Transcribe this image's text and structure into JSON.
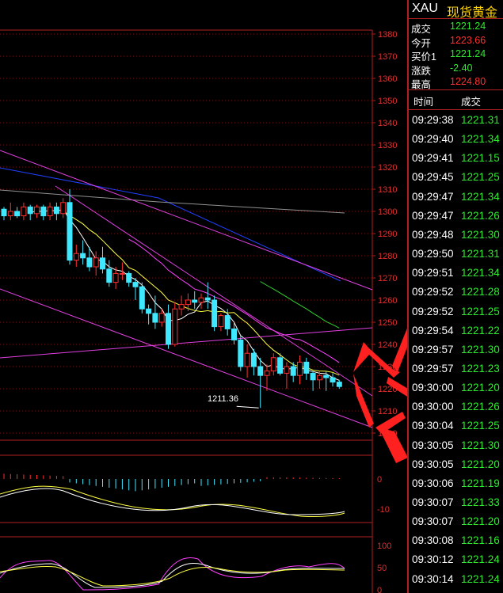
{
  "header": {
    "symbol": "XAU",
    "name": "现货黄金"
  },
  "quote": [
    {
      "label": "成交",
      "value": "1221.24",
      "color": "#2fe82f"
    },
    {
      "label": "今开",
      "value": "1223.66",
      "color": "#ff3030"
    },
    {
      "label": "买价1",
      "value": "1221.24",
      "color": "#2fe82f"
    },
    {
      "label": "涨跌",
      "value": "-2.40",
      "color": "#2fe82f"
    },
    {
      "label": "最高",
      "value": "1224.80",
      "color": "#ff3030"
    }
  ],
  "ticks_header": {
    "time": "时间",
    "price": "成交"
  },
  "ticks": [
    {
      "time": "09:29:38",
      "price": "1221.31"
    },
    {
      "time": "09:29:40",
      "price": "1221.34"
    },
    {
      "time": "09:29:41",
      "price": "1221.15"
    },
    {
      "time": "09:29:45",
      "price": "1221.25"
    },
    {
      "time": "09:29:47",
      "price": "1221.34"
    },
    {
      "time": "09:29:47",
      "price": "1221.26"
    },
    {
      "time": "09:29:48",
      "price": "1221.30"
    },
    {
      "time": "09:29:50",
      "price": "1221.31"
    },
    {
      "time": "09:29:51",
      "price": "1221.34"
    },
    {
      "time": "09:29:52",
      "price": "1221.28"
    },
    {
      "time": "09:29:52",
      "price": "1221.25"
    },
    {
      "time": "09:29:54",
      "price": "1221.22"
    },
    {
      "time": "09:29:57",
      "price": "1221.30"
    },
    {
      "time": "09:29:57",
      "price": "1221.23"
    },
    {
      "time": "09:30:00",
      "price": "1221.20"
    },
    {
      "time": "09:30:00",
      "price": "1221.26"
    },
    {
      "time": "09:30:04",
      "price": "1221.25"
    },
    {
      "time": "09:30:05",
      "price": "1221.30"
    },
    {
      "time": "09:30:05",
      "price": "1221.20"
    },
    {
      "time": "09:30:06",
      "price": "1221.19"
    },
    {
      "time": "09:30:07",
      "price": "1221.33"
    },
    {
      "time": "09:30:07",
      "price": "1221.20"
    },
    {
      "time": "09:30:08",
      "price": "1221.16"
    },
    {
      "time": "09:30:12",
      "price": "1221.24"
    },
    {
      "time": "09:30:14",
      "price": "1221.24"
    }
  ],
  "price_axis": {
    "ticks": [
      "1380",
      "1370",
      "1360",
      "1350",
      "1340",
      "1330",
      "1320",
      "1310",
      "1300",
      "1290",
      "1280",
      "1270",
      "1260",
      "1250",
      "1240",
      "1230",
      "1220",
      "1210",
      "1200"
    ],
    "min": 1200,
    "max": 1380
  },
  "low_annotation": "1211.36",
  "macd_axis": [
    "0",
    "-10"
  ],
  "kdj_axis": [
    "100",
    "50",
    "0"
  ],
  "colors": {
    "up": "#ff3030",
    "down": "#40e8ff",
    "frame": "#b02020",
    "ticks_text": "#2fe82f"
  },
  "chart_data": {
    "type": "candlestick",
    "y_range": [
      1200,
      1380
    ],
    "candles": [
      [
        1301,
        1302,
        1296,
        1298
      ],
      [
        1298,
        1304,
        1296,
        1300
      ],
      [
        1300,
        1302,
        1297,
        1298
      ],
      [
        1298,
        1304,
        1296,
        1302
      ],
      [
        1302,
        1303,
        1296,
        1299
      ],
      [
        1299,
        1303,
        1297,
        1302
      ],
      [
        1302,
        1303,
        1296,
        1298
      ],
      [
        1298,
        1304,
        1296,
        1302
      ],
      [
        1302,
        1304,
        1296,
        1299
      ],
      [
        1299,
        1306,
        1297,
        1304
      ],
      [
        1304,
        1310,
        1276,
        1278
      ],
      [
        1278,
        1285,
        1275,
        1281
      ],
      [
        1281,
        1287,
        1276,
        1279
      ],
      [
        1279,
        1284,
        1273,
        1275
      ],
      [
        1275,
        1282,
        1271,
        1279
      ],
      [
        1279,
        1284,
        1272,
        1274
      ],
      [
        1274,
        1278,
        1266,
        1268
      ],
      [
        1268,
        1275,
        1265,
        1272
      ],
      [
        1272,
        1277,
        1269,
        1272
      ],
      [
        1272,
        1273,
        1266,
        1268
      ],
      [
        1268,
        1270,
        1260,
        1266
      ],
      [
        1266,
        1268,
        1254,
        1256
      ],
      [
        1256,
        1258,
        1249,
        1254
      ],
      [
        1254,
        1262,
        1247,
        1250
      ],
      [
        1250,
        1256,
        1248,
        1254
      ],
      [
        1254,
        1258,
        1238,
        1240
      ],
      [
        1240,
        1259,
        1239,
        1256
      ],
      [
        1256,
        1262,
        1253,
        1258
      ],
      [
        1258,
        1263,
        1255,
        1260
      ],
      [
        1260,
        1264,
        1256,
        1259
      ],
      [
        1259,
        1263,
        1256,
        1261
      ],
      [
        1261,
        1268,
        1256,
        1260
      ],
      [
        1260,
        1262,
        1246,
        1248
      ],
      [
        1248,
        1254,
        1246,
        1253
      ],
      [
        1253,
        1256,
        1244,
        1247
      ],
      [
        1247,
        1250,
        1240,
        1242
      ],
      [
        1242,
        1244,
        1228,
        1230
      ],
      [
        1230,
        1240,
        1225,
        1236
      ],
      [
        1236,
        1238,
        1226,
        1230
      ],
      [
        1230,
        1234,
        1211.36,
        1226
      ],
      [
        1226,
        1231,
        1219,
        1228
      ],
      [
        1228,
        1236,
        1226,
        1234
      ],
      [
        1234,
        1236,
        1226,
        1227
      ],
      [
        1227,
        1232,
        1220,
        1230
      ],
      [
        1230,
        1232,
        1223,
        1226
      ],
      [
        1226,
        1235,
        1222,
        1232
      ],
      [
        1232,
        1234,
        1224,
        1227
      ],
      [
        1227,
        1228,
        1219,
        1224
      ],
      [
        1224,
        1228,
        1220,
        1226
      ],
      [
        1226,
        1228,
        1219,
        1225
      ],
      [
        1225,
        1227,
        1221,
        1223
      ],
      [
        1223,
        1224,
        1220,
        1221
      ]
    ]
  }
}
